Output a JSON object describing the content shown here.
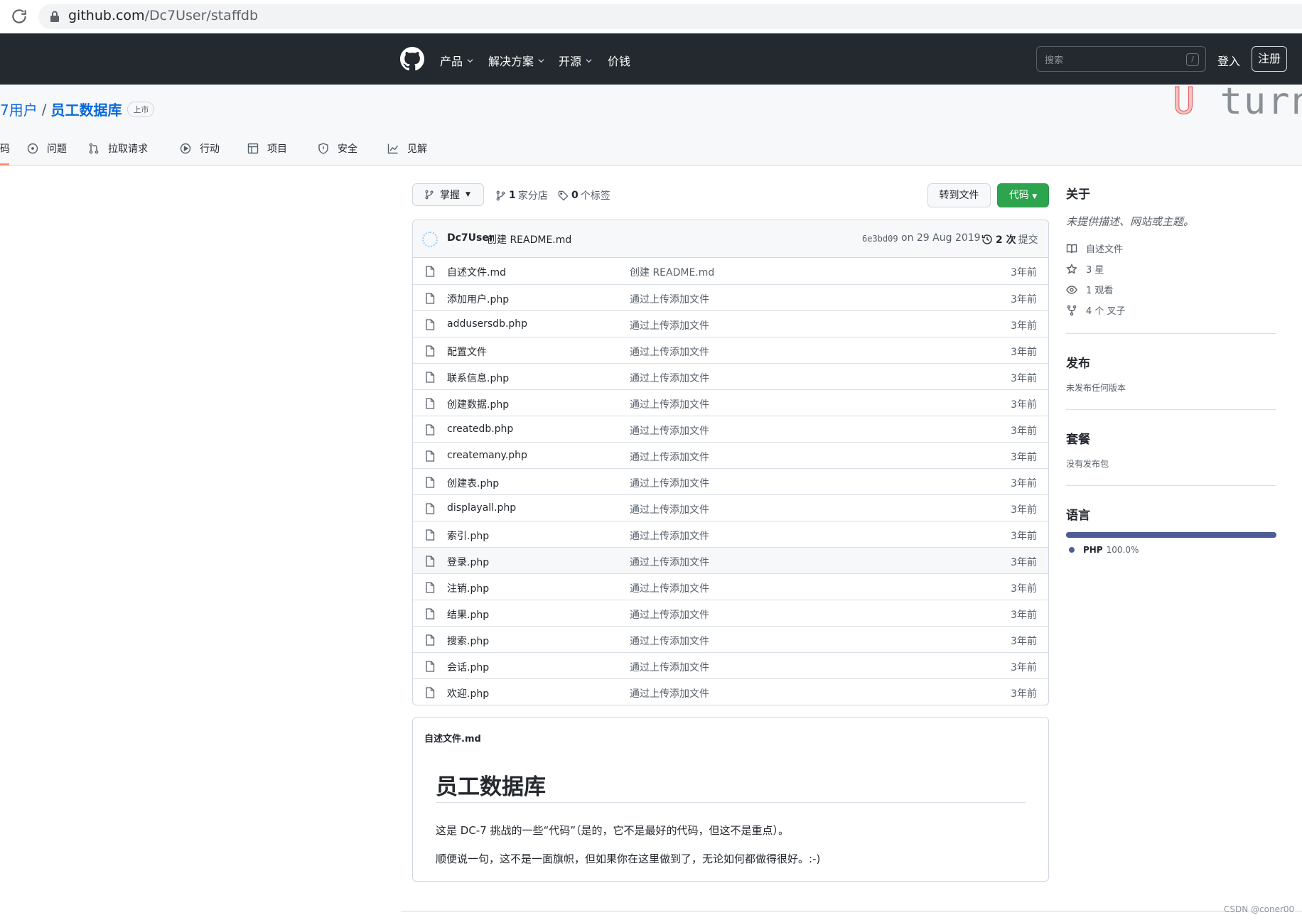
{
  "browser": {
    "url_host": "github.com",
    "url_path": "/Dc7User/staffdb"
  },
  "header": {
    "nav": [
      "产品",
      "解决方案",
      "开源",
      "价钱"
    ],
    "search_placeholder": "搜索",
    "search_shortcut": "/",
    "signin": "登入",
    "signup": "注册"
  },
  "repo": {
    "owner": "7用户",
    "separator": "/",
    "name": "员工数据库",
    "visibility": "上市",
    "watermark_u": "U",
    "watermark_rest": " turn m",
    "tabs": [
      {
        "label": "码",
        "icon": "code-icon",
        "active": true
      },
      {
        "label": "问题",
        "icon": "issue-icon"
      },
      {
        "label": "拉取请求",
        "icon": "pull-request-icon"
      },
      {
        "label": "行动",
        "icon": "play-icon"
      },
      {
        "label": "项目",
        "icon": "table-icon"
      },
      {
        "label": "安全",
        "icon": "shield-icon"
      },
      {
        "label": "见解",
        "icon": "graph-icon"
      }
    ]
  },
  "toolbar": {
    "branch": "掌握",
    "branches_count": "1",
    "branches_label": "家分店",
    "tags_count": "0",
    "tags_label": "个标签",
    "goto_file": "转到文件",
    "code": "代码"
  },
  "commit": {
    "author": "Dc7User",
    "message": "创建 README.md",
    "sha": "6e3bd09",
    "date": "on 29 Aug 2019",
    "count": "2 次",
    "count_label": "提交"
  },
  "files": [
    {
      "name": "自述文件.md",
      "message": "创建 README.md",
      "age": "3年前"
    },
    {
      "name": "添加用户.php",
      "message": "通过上传添加文件",
      "age": "3年前"
    },
    {
      "name": "addusersdb.php",
      "message": "通过上传添加文件",
      "age": "3年前"
    },
    {
      "name": "配置文件",
      "message": "通过上传添加文件",
      "age": "3年前"
    },
    {
      "name": "联系信息.php",
      "message": "通过上传添加文件",
      "age": "3年前"
    },
    {
      "name": "创建数据.php",
      "message": "通过上传添加文件",
      "age": "3年前"
    },
    {
      "name": "createdb.php",
      "message": "通过上传添加文件",
      "age": "3年前"
    },
    {
      "name": "createmany.php",
      "message": "通过上传添加文件",
      "age": "3年前"
    },
    {
      "name": "创建表.php",
      "message": "通过上传添加文件",
      "age": "3年前"
    },
    {
      "name": "displayall.php",
      "message": "通过上传添加文件",
      "age": "3年前"
    },
    {
      "name": "索引.php",
      "message": "通过上传添加文件",
      "age": "3年前"
    },
    {
      "name": "登录.php",
      "message": "通过上传添加文件",
      "age": "3年前"
    },
    {
      "name": "注销.php",
      "message": "通过上传添加文件",
      "age": "3年前"
    },
    {
      "name": "结果.php",
      "message": "通过上传添加文件",
      "age": "3年前"
    },
    {
      "name": "搜索.php",
      "message": "通过上传添加文件",
      "age": "3年前"
    },
    {
      "name": "会话.php",
      "message": "通过上传添加文件",
      "age": "3年前"
    },
    {
      "name": "欢迎.php",
      "message": "通过上传添加文件",
      "age": "3年前"
    }
  ],
  "readme": {
    "label": "自述文件.md",
    "title": "员工数据库",
    "p1": "这是 DC-7 挑战的一些“代码”（是的，它不是最好的代码，但这不是重点）。",
    "p2": "顺便说一句，这不是一面旗帜，但如果你在这里做到了，无论如何都做得很好。:-)"
  },
  "sidebar": {
    "about_title": "关于",
    "about_desc": "未提供描述、网站或主题。",
    "readme_link": "自述文件",
    "stars": "3 星",
    "watching": "1 观看",
    "forks": "4 个 叉子",
    "releases_title": "发布",
    "releases_text": "未发布任何版本",
    "packages_title": "套餐",
    "packages_text": "没有发布包",
    "languages_title": "语言",
    "language_name": "PHP",
    "language_pct": "100.0%",
    "language_share": 1.0,
    "language_color": "#4f5d95"
  },
  "watermark_text": "CSDN @coner00"
}
